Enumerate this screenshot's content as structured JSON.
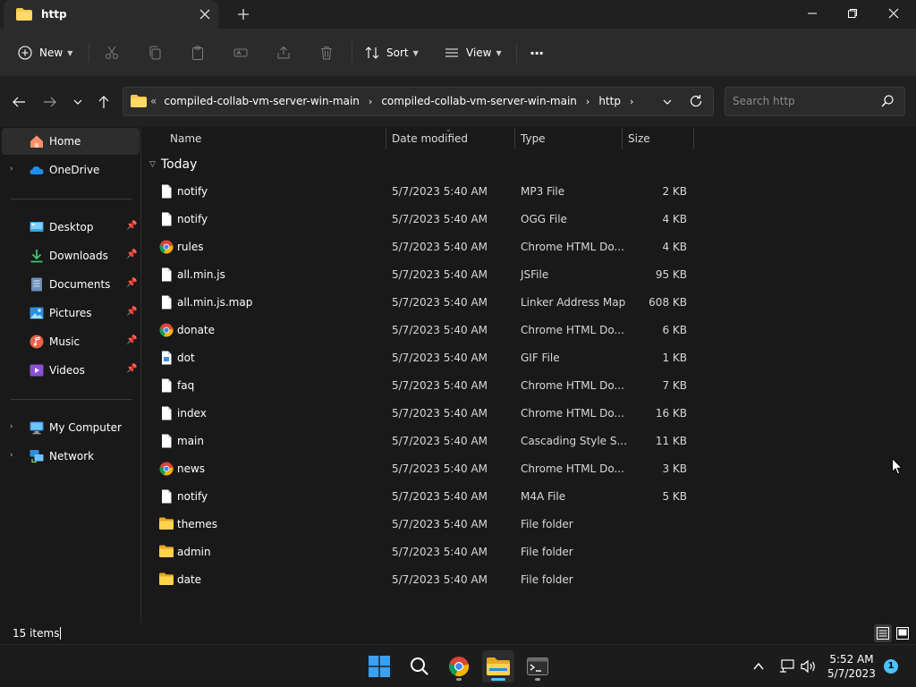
{
  "window": {
    "tab_title": "http"
  },
  "toolbar": {
    "new_label": "New",
    "sort_label": "Sort",
    "view_label": "View",
    "more_label": "···"
  },
  "address": {
    "overflow": "«",
    "crumbs": [
      "compiled-collab-vm-server-win-main",
      "compiled-collab-vm-server-win-main",
      "http"
    ]
  },
  "search": {
    "placeholder": "Search http"
  },
  "sidebar": {
    "items": [
      {
        "label": "Home",
        "icon": "home-icon"
      },
      {
        "label": "OneDrive",
        "icon": "cloud-icon"
      },
      {
        "label": "Desktop",
        "icon": "desktop-icon"
      },
      {
        "label": "Downloads",
        "icon": "download-icon"
      },
      {
        "label": "Documents",
        "icon": "documents-icon"
      },
      {
        "label": "Pictures",
        "icon": "pictures-icon"
      },
      {
        "label": "Music",
        "icon": "music-icon"
      },
      {
        "label": "Videos",
        "icon": "videos-icon"
      },
      {
        "label": "My Computer",
        "icon": "computer-icon"
      },
      {
        "label": "Network",
        "icon": "network-icon"
      }
    ]
  },
  "columns": {
    "name": "Name",
    "date": "Date modified",
    "type": "Type",
    "size": "Size"
  },
  "group_label": "Today",
  "files": [
    {
      "name": "notify",
      "date": "5/7/2023 5:40 AM",
      "type": "MP3 File",
      "size": "2 KB",
      "icon": "file-icon"
    },
    {
      "name": "notify",
      "date": "5/7/2023 5:40 AM",
      "type": "OGG File",
      "size": "4 KB",
      "icon": "file-icon"
    },
    {
      "name": "rules",
      "date": "5/7/2023 5:40 AM",
      "type": "Chrome HTML Do...",
      "size": "4 KB",
      "icon": "chrome-icon"
    },
    {
      "name": "all.min.js",
      "date": "5/7/2023 5:40 AM",
      "type": "JSFile",
      "size": "95 KB",
      "icon": "file-icon"
    },
    {
      "name": "all.min.js.map",
      "date": "5/7/2023 5:40 AM",
      "type": "Linker Address Map",
      "size": "608 KB",
      "icon": "file-icon"
    },
    {
      "name": "donate",
      "date": "5/7/2023 5:40 AM",
      "type": "Chrome HTML Do...",
      "size": "6 KB",
      "icon": "chrome-icon"
    },
    {
      "name": "dot",
      "date": "5/7/2023 5:40 AM",
      "type": "GIF File",
      "size": "1 KB",
      "icon": "image-file-icon"
    },
    {
      "name": "faq",
      "date": "5/7/2023 5:40 AM",
      "type": "Chrome HTML Do...",
      "size": "7 KB",
      "icon": "file-icon"
    },
    {
      "name": "index",
      "date": "5/7/2023 5:40 AM",
      "type": "Chrome HTML Do...",
      "size": "16 KB",
      "icon": "file-icon"
    },
    {
      "name": "main",
      "date": "5/7/2023 5:40 AM",
      "type": "Cascading Style S...",
      "size": "11 KB",
      "icon": "file-icon"
    },
    {
      "name": "news",
      "date": "5/7/2023 5:40 AM",
      "type": "Chrome HTML Do...",
      "size": "3 KB",
      "icon": "chrome-icon"
    },
    {
      "name": "notify",
      "date": "5/7/2023 5:40 AM",
      "type": "M4A File",
      "size": "5 KB",
      "icon": "file-icon"
    },
    {
      "name": "themes",
      "date": "5/7/2023 5:40 AM",
      "type": "File folder",
      "size": "",
      "icon": "folder-icon"
    },
    {
      "name": "admin",
      "date": "5/7/2023 5:40 AM",
      "type": "File folder",
      "size": "",
      "icon": "folder-icon"
    },
    {
      "name": "date",
      "date": "5/7/2023 5:40 AM",
      "type": "File folder",
      "size": "",
      "icon": "folder-icon"
    }
  ],
  "status": {
    "item_count": "15 items"
  },
  "taskbar": {
    "time": "5:52 AM",
    "date": "5/7/2023",
    "notification_count": "1"
  },
  "colors": {
    "accent": "#4cc2ff",
    "folder": "#f7c948",
    "background": "#191919"
  }
}
